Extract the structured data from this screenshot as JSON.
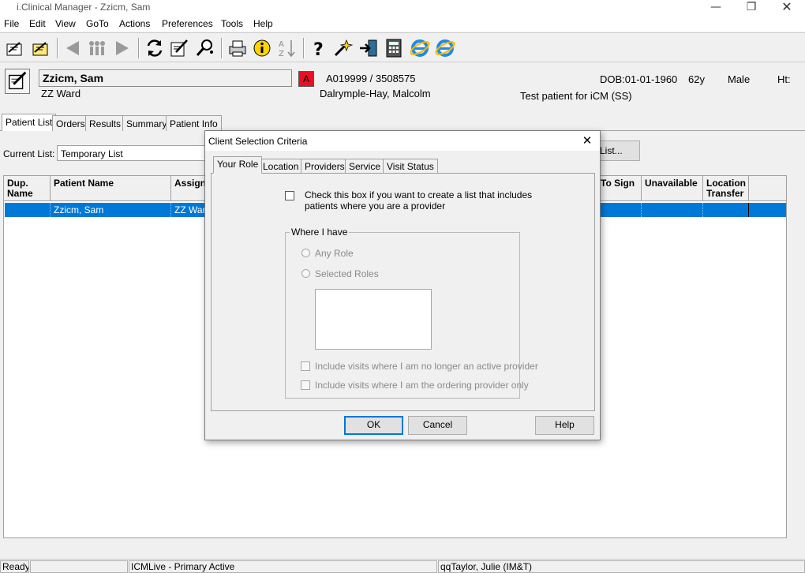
{
  "window": {
    "title": "i.Clinical Manager - Zzicm, Sam",
    "controls": [
      "minimize-icon",
      "restore-icon",
      "close-icon"
    ]
  },
  "menu": [
    "File",
    "Edit",
    "View",
    "GoTo",
    "Actions",
    "Preferences",
    "Tools",
    "Help"
  ],
  "toolbar_icons": [
    "handwriting-icon",
    "sign-icon",
    "back-arrow-icon",
    "people-icon",
    "forward-arrow-icon",
    "refresh-icon",
    "edit-note-icon",
    "search-patient-icon",
    "printer-icon",
    "info-icon",
    "sort-az-icon",
    "help-question-icon",
    "wizard-icon",
    "exit-icon",
    "calculator-icon",
    "internet-explorer-icon",
    "internet-explorer-icon"
  ],
  "patient": {
    "name": "Zzicm, Sam",
    "ward": "ZZ Ward",
    "alert_badge": "A",
    "ids": "A019999 / 3508575",
    "provider": "Dalrymple-Hay, Malcolm",
    "dob": "DOB:01-01-1960",
    "age": "62y",
    "sex": "Male",
    "height_label": "Ht:",
    "note": "Test patient for iCM (SS)"
  },
  "tabs": [
    "Patient List",
    "Orders",
    "Results",
    "Summary",
    "Patient Info"
  ],
  "current_list": {
    "label": "Current List:",
    "value": "Temporary List",
    "list_button": "List..."
  },
  "grid": {
    "headers_left": [
      "Dup. Name",
      "Patient Name",
      "Assigne"
    ],
    "headers_right": [
      "To Sign",
      "Unavailable",
      "Location Transfer"
    ],
    "rows": [
      {
        "patient_name": "Zzicm, Sam",
        "assigned": "ZZ Ward"
      }
    ]
  },
  "status": {
    "ready": "Ready",
    "empty": "",
    "connection": "ICMLive - Primary Active",
    "user": "qqTaylor, Julie (IM&T)"
  },
  "dialog": {
    "title": "Client Selection Criteria",
    "tabs": [
      "Your Role",
      "Location",
      "Providers",
      "Service",
      "Visit Status"
    ],
    "checkbox_provider": "Check this box if you want to create a list that includes patients where you are a provider",
    "group_label": "Where I have",
    "radio_any": "Any Role",
    "radio_selected": "Selected Roles",
    "check_no_longer": "Include visits where I am no longer an active provider",
    "check_ordering": "Include visits where I am the ordering provider only",
    "ok": "OK",
    "cancel": "Cancel",
    "help": "Help"
  },
  "colors": {
    "selection": "#0078d7",
    "alert_red": "#e81123",
    "default_button_border": "#0078d7"
  }
}
